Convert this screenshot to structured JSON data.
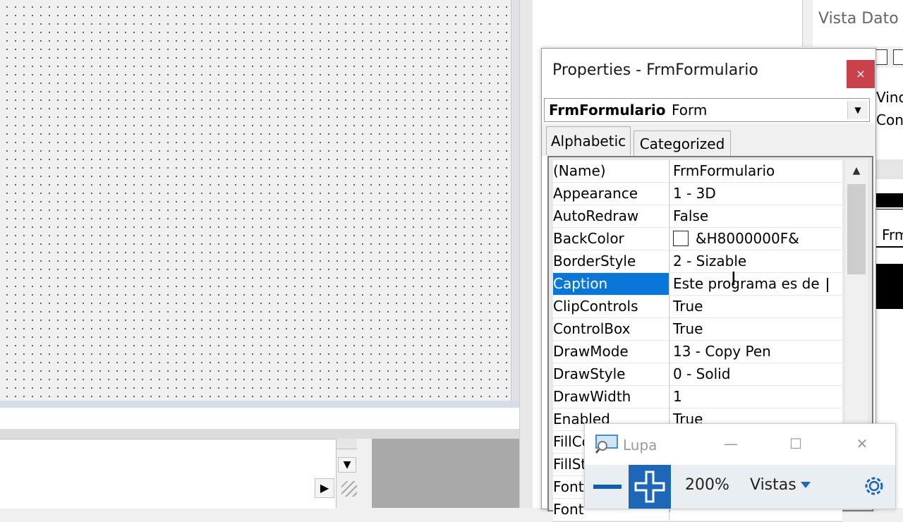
{
  "right_window": {
    "title": "Vista Dato",
    "side_items": [
      "Vinc",
      "Con",
      "Frm"
    ]
  },
  "properties": {
    "title": "Properties - FrmFormulario",
    "close_label": "×",
    "object_name": "FrmFormulario",
    "object_type": "Form",
    "tabs": [
      "Alphabetic",
      "Categorized"
    ],
    "active_tab": "Alphabetic",
    "rows": [
      {
        "name": "(Name)",
        "value": "FrmFormulario"
      },
      {
        "name": "Appearance",
        "value": "1 - 3D"
      },
      {
        "name": "AutoRedraw",
        "value": "False"
      },
      {
        "name": "BackColor",
        "value": "&H8000000F&"
      },
      {
        "name": "BorderStyle",
        "value": "2 - Sizable"
      },
      {
        "name": "Caption",
        "value": "Este programa es de "
      },
      {
        "name": "ClipControls",
        "value": "True"
      },
      {
        "name": "ControlBox",
        "value": "True"
      },
      {
        "name": "DrawMode",
        "value": "13 - Copy Pen"
      },
      {
        "name": "DrawStyle",
        "value": "0 - Solid"
      },
      {
        "name": "DrawWidth",
        "value": "1"
      },
      {
        "name": "Enabled",
        "value": "True"
      },
      {
        "name": "FillCo",
        "value": ""
      },
      {
        "name": "FillSt",
        "value": ""
      },
      {
        "name": "Font",
        "value": ""
      },
      {
        "name": "Font",
        "value": ""
      }
    ],
    "selected_row": "Caption",
    "colors": {
      "selection": "#0a77d8",
      "close": "#c8414b"
    }
  },
  "lupa": {
    "title": "Lupa",
    "zoom": "200%",
    "views_label": "Vistas",
    "minimize": "—",
    "maximize": "☐",
    "close": "✕",
    "colors": {
      "accent": "#1e66b8"
    }
  }
}
